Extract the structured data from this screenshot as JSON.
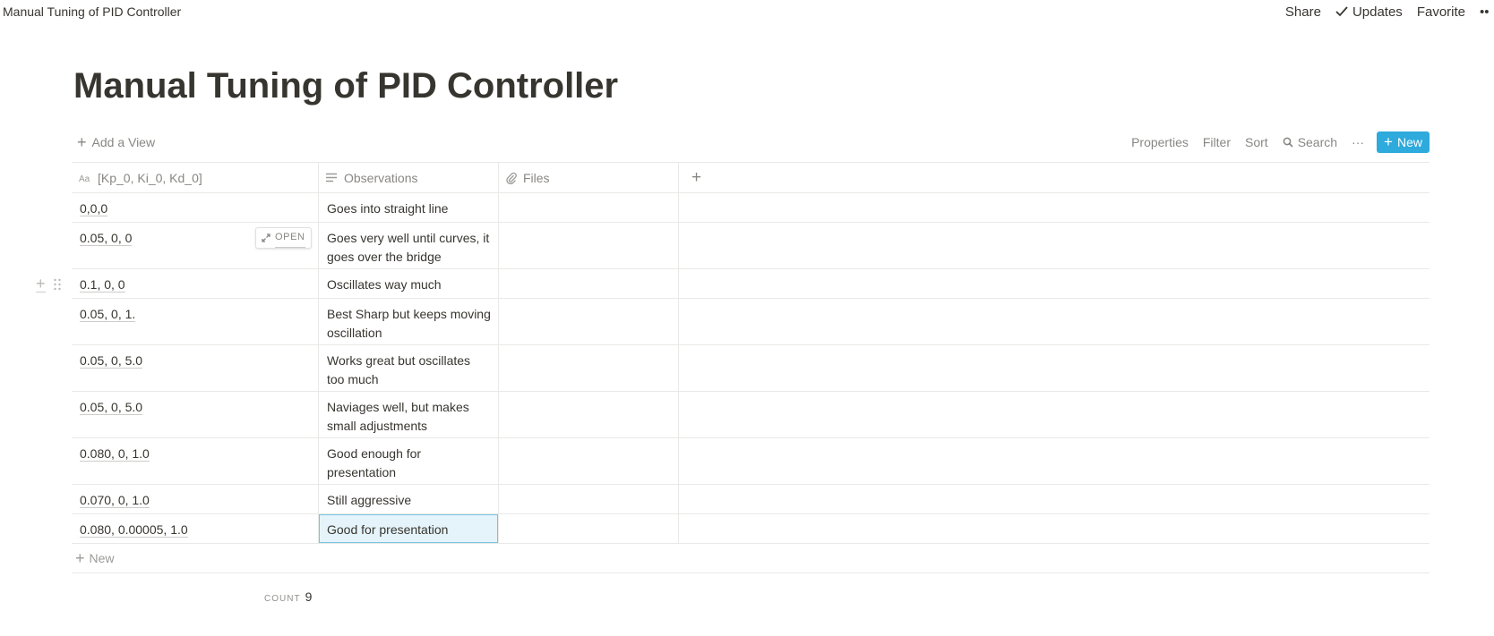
{
  "topbar": {
    "breadcrumb": "Manual Tuning of PID Controller",
    "share": "Share",
    "updates": "Updates",
    "favorite": "Favorite",
    "more": "••"
  },
  "page": {
    "title": "Manual Tuning of PID Controller"
  },
  "viewbar": {
    "add_view": "Add a View",
    "properties": "Properties",
    "filter": "Filter",
    "sort": "Sort",
    "search": "Search",
    "more": "···",
    "new": "New"
  },
  "table": {
    "columns": [
      "[Kp_0, Ki_0, Kd_0]",
      "Observations",
      "Files",
      "+"
    ],
    "open_label": "OPEN",
    "rows": [
      {
        "name": "0,0,0",
        "obs": "Goes into straight line"
      },
      {
        "name": "0.05, 0, 0",
        "obs": "Goes very well until curves, it goes over the bridge"
      },
      {
        "name": "0.1, 0, 0",
        "obs": "Oscillates way much"
      },
      {
        "name": "0.05, 0, 1.",
        "obs": "Best Sharp but keeps moving oscillation"
      },
      {
        "name": "0.05, 0, 5.0",
        "obs": "Works great but oscillates too much"
      },
      {
        "name": "0.05, 0, 5.0",
        "obs": "Naviages well, but makes small adjustments"
      },
      {
        "name": "0.080, 0, 1.0",
        "obs": "Good enough for presentation"
      },
      {
        "name": "0.070, 0, 1.0",
        "obs": "Still aggressive"
      },
      {
        "name": "0.080, 0.00005, 1.0",
        "obs": "Good for presentation"
      }
    ],
    "new_row": "New",
    "count_label": "COUNT",
    "count_value": "9"
  },
  "icons": {
    "title_type": "Aa-text-icon",
    "observations_type": "lines-text-icon",
    "files_type": "paperclip-icon"
  }
}
